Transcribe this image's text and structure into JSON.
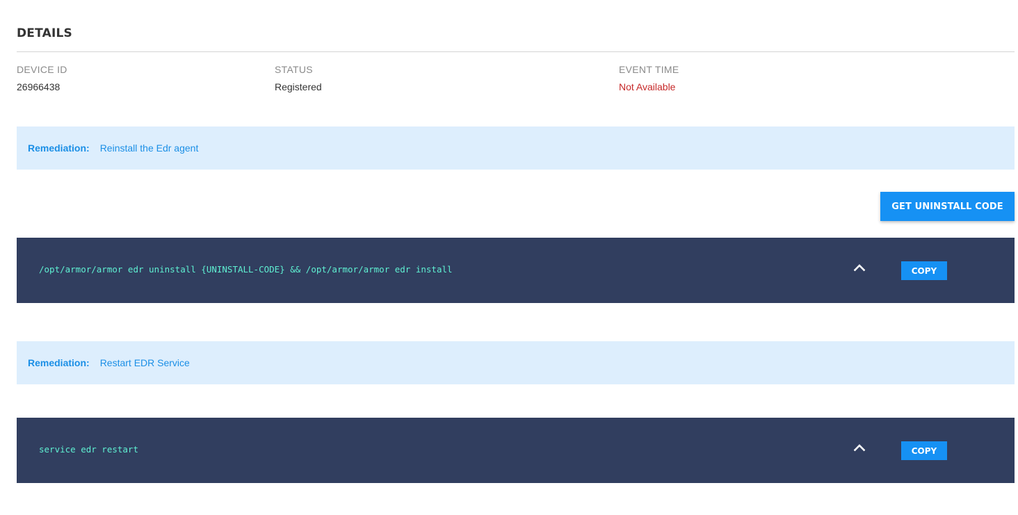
{
  "details": {
    "title": "DETAILS",
    "fields": [
      {
        "label": "DEVICE ID",
        "value": "26966438"
      },
      {
        "label": "STATUS",
        "value": "Registered"
      },
      {
        "label": "EVENT TIME",
        "value": "Not Available"
      }
    ]
  },
  "remediations": [
    {
      "label": "Remediation:",
      "text": "Reinstall the Edr agent",
      "action_button": "GET UNINSTALL CODE",
      "command": "/opt/armor/armor edr uninstall {UNINSTALL-CODE} && /opt/armor/armor edr install",
      "copy_label": "COPY",
      "collapse_icon": "chevron-up-icon"
    },
    {
      "label": "Remediation:",
      "text": "Restart EDR Service",
      "command": "service edr restart",
      "copy_label": "COPY",
      "collapse_icon": "chevron-up-icon"
    }
  ],
  "colors": {
    "accent": "#1691f4",
    "remediation_bg": "#ddeefd",
    "code_bg": "#313e5f",
    "code_text": "#5ff0d2",
    "unavailable": "#c62828"
  }
}
